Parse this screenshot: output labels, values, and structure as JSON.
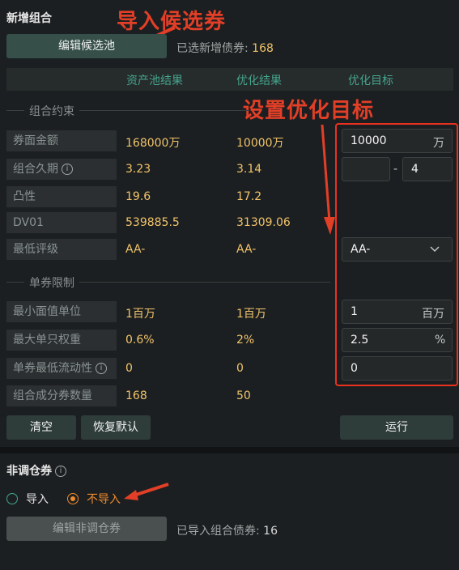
{
  "new_group": {
    "title": "新增组合",
    "edit_candidates_button": "编辑候选池",
    "selected_count_label": "已选新增债券:",
    "selected_count": "168"
  },
  "annotations": {
    "import_candidates": "导入候选券",
    "set_targets": "设置优化目标"
  },
  "table_header": {
    "col1": "资产池结果",
    "col2": "优化结果",
    "col3": "优化目标"
  },
  "constraints": {
    "title": "组合约束",
    "rows": [
      {
        "label": "券面金额",
        "pool": "168000万",
        "opt": "10000万"
      },
      {
        "label": "组合久期",
        "pool": "3.23",
        "opt": "3.14"
      },
      {
        "label": "凸性",
        "pool": "19.6",
        "opt": "17.2"
      },
      {
        "label": "DV01",
        "pool": "539885.5",
        "opt": "31309.06"
      },
      {
        "label": "最低评级",
        "pool": "AA-",
        "opt": "AA-"
      }
    ],
    "targets": {
      "face_value": "10000",
      "face_value_unit": "万",
      "duration_min": "",
      "duration_sep": "-",
      "duration_max": "4",
      "rating": "AA-"
    }
  },
  "single_limits": {
    "title": "单券限制",
    "rows": [
      {
        "label": "最小面值单位",
        "pool": "1百万",
        "opt": "1百万"
      },
      {
        "label": "最大单只权重",
        "pool": "0.6%",
        "opt": "2%"
      },
      {
        "label": "单券最低流动性",
        "pool": "0",
        "opt": "0"
      },
      {
        "label": "组合成分券数量",
        "pool": "168",
        "opt": "50"
      }
    ],
    "targets": {
      "min_unit": "1",
      "min_unit_unit": "百万",
      "max_weight": "2.5",
      "max_weight_unit": "%",
      "min_liquidity": "0"
    }
  },
  "actions": {
    "clear": "清空",
    "restore": "恢复默认",
    "run": "运行"
  },
  "non_adjust": {
    "title": "非调仓券",
    "option_import": "导入",
    "option_no_import": "不导入",
    "edit_button": "编辑非调仓券",
    "imported_label": "已导入组合债券:",
    "imported_count": "16"
  },
  "colors": {
    "annotation_red": "#e33f27",
    "accent_green": "#46a58d",
    "value_yellow": "#f1c46a",
    "radio_orange": "#ef8a2a"
  }
}
